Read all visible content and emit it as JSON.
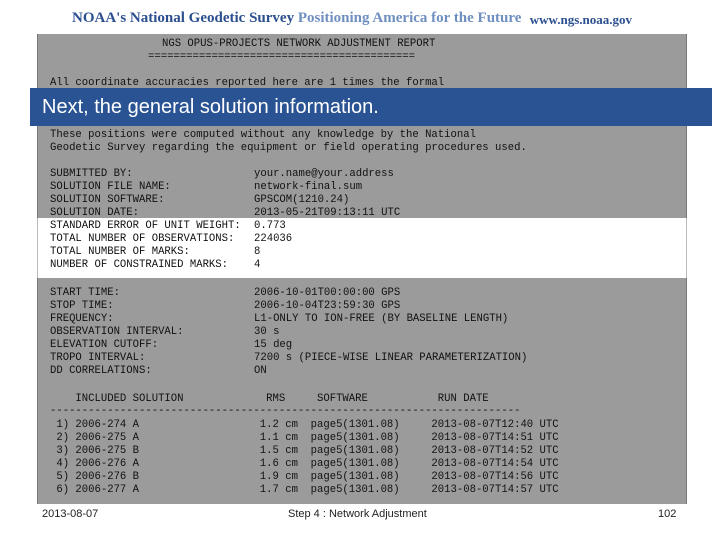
{
  "header": {
    "left_prefix": "NOAA's National Geodetic Survey ",
    "left_tag": "Positioning America for the Future",
    "url": "www.ngs.noaa.gov"
  },
  "report": {
    "title": "NGS OPUS-PROJECTS NETWORK ADJUSTMENT REPORT",
    "rule": "==========================================",
    "accuracy_line": "All coordinate accuracies reported here are 1 times the formal",
    "disclaimer_1": "These positions were computed without any knowledge by the National",
    "disclaimer_2": "Geodetic Survey regarding the equipment or field operating procedures used.",
    "info": [
      {
        "label": "SUBMITTED BY:",
        "value": "your.name@your.address"
      },
      {
        "label": "SOLUTION FILE NAME:",
        "value": "network-final.sum"
      },
      {
        "label": "SOLUTION SOFTWARE:",
        "value": "GPSCOM(1210.24)"
      },
      {
        "label": "SOLUTION DATE:",
        "value": "2013-05-21T09:13:11 UTC"
      },
      {
        "label": "STANDARD ERROR OF UNIT WEIGHT:",
        "value": "0.773"
      },
      {
        "label": "TOTAL NUMBER OF OBSERVATIONS:",
        "value": "224036"
      },
      {
        "label": "TOTAL NUMBER OF MARKS:",
        "value": "8"
      },
      {
        "label": "NUMBER OF CONSTRAINED MARKS:",
        "value": "4"
      }
    ],
    "timing": [
      {
        "label": "START TIME:",
        "value": "2006-10-01T00:00:00 GPS"
      },
      {
        "label": "STOP TIME:",
        "value": "2006-10-04T23:59:30 GPS"
      },
      {
        "label": "FREQUENCY:",
        "value": "L1-ONLY TO ION-FREE (BY BASELINE LENGTH)"
      },
      {
        "label": "OBSERVATION INTERVAL:",
        "value": "30 s"
      },
      {
        "label": "ELEVATION CUTOFF:",
        "value": "15 deg"
      },
      {
        "label": "TROPO INTERVAL:",
        "value": "7200 s (PIECE-WISE LINEAR PARAMETERIZATION)"
      },
      {
        "label": "DD CORRELATIONS:",
        "value": "ON"
      }
    ],
    "table_header": "    INCLUDED SOLUTION             RMS     SOFTWARE           RUN DATE",
    "table_rule": "--------------------------------------------------------------------------",
    "rows": [
      " 1) 2006-274 A                   1.2 cm  page5(1301.08)     2013-08-07T12:40 UTC",
      " 2) 2006-275 A                   1.1 cm  page5(1301.08)     2013-08-07T14:51 UTC",
      " 3) 2006-275 B                   1.5 cm  page5(1301.08)     2013-08-07T14:52 UTC",
      " 4) 2006-276 A                   1.6 cm  page5(1301.08)     2013-08-07T14:54 UTC",
      " 5) 2006-276 B                   1.9 cm  page5(1301.08)     2013-08-07T14:56 UTC",
      " 6) 2006-277 A                   1.7 cm  page5(1301.08)     2013-08-07T14:57 UTC"
    ]
  },
  "banner": "Next, the general solution information.",
  "footer": {
    "date": "2013-08-07",
    "step": "Step 4 : Network Adjustment",
    "page": "102"
  },
  "colors": {
    "banner": "#2a5394",
    "panel": "#9b9b9b",
    "brand": "#2b4f8f"
  }
}
